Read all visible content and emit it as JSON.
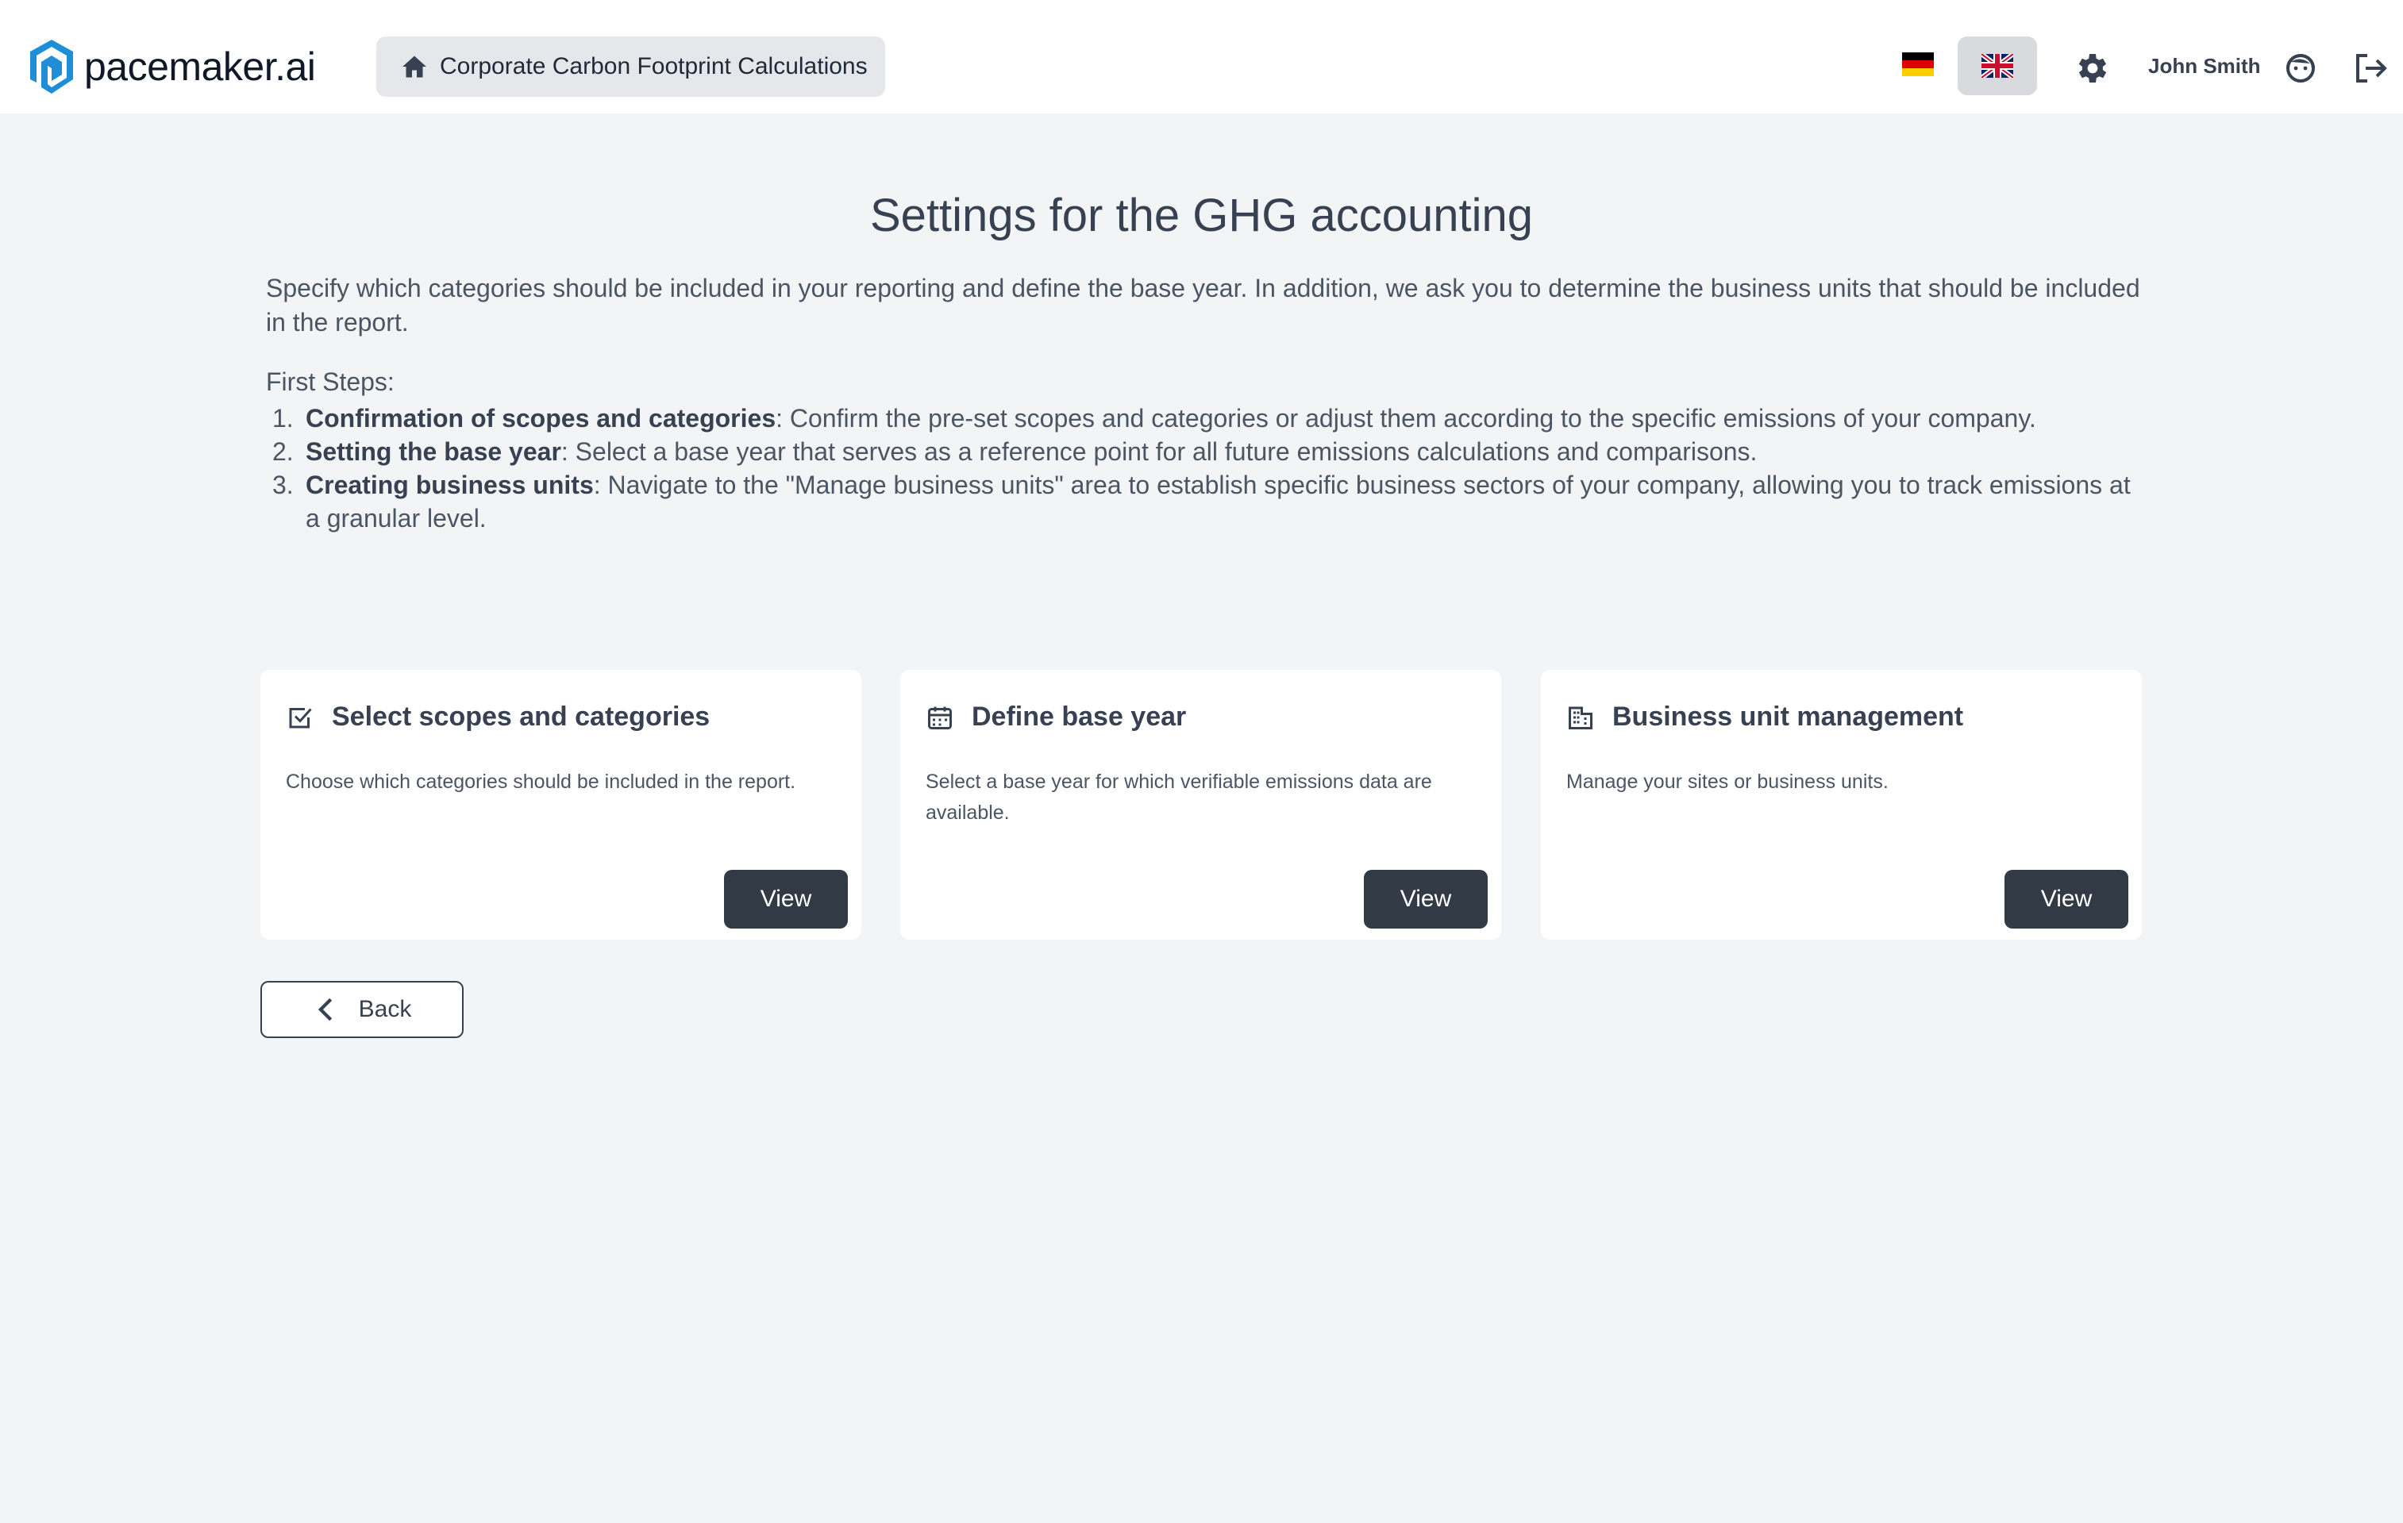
{
  "header": {
    "logo_text": "pacemaker.ai",
    "breadcrumb": "Corporate Carbon Footprint Calculations",
    "user_name": "John Smith",
    "languages": [
      {
        "code": "de",
        "name": "german-flag-icon"
      },
      {
        "code": "en",
        "name": "uk-flag-icon",
        "selected": true
      }
    ],
    "accent_color": "#1e8fd6"
  },
  "main": {
    "title": "Settings for the GHG accounting",
    "intro": "Specify which categories should be included in your reporting and define the base year. In addition, we ask you to determine the business units that should be included in the report.",
    "steps_heading": "First Steps:",
    "steps": [
      {
        "num": "1.",
        "bold": "Confirmation of scopes and categories",
        "text": ": Confirm the pre-set scopes and categories or adjust them according to the specific emissions of your company."
      },
      {
        "num": "2.",
        "bold": "Setting the base year",
        "text": ": Select a base year that serves as a reference point for all future emissions calculations and comparisons."
      },
      {
        "num": "3.",
        "bold": "Creating business units",
        "text": ": Navigate to the \"Manage business units\" area to establish specific business sectors of your company, allowing you to track emissions at a granular level."
      }
    ],
    "cards": [
      {
        "icon": "checkbox-icon",
        "title": "Select scopes and categories",
        "description": "Choose which categories should be included in the report.",
        "button": "View"
      },
      {
        "icon": "calendar-icon",
        "title": "Define base year",
        "description": "Select a base year for which verifiable emissions data are available.",
        "button": "View"
      },
      {
        "icon": "building-icon",
        "title": "Business unit management",
        "description": "Manage your sites or business units.",
        "button": "View"
      }
    ],
    "back_label": "Back"
  }
}
